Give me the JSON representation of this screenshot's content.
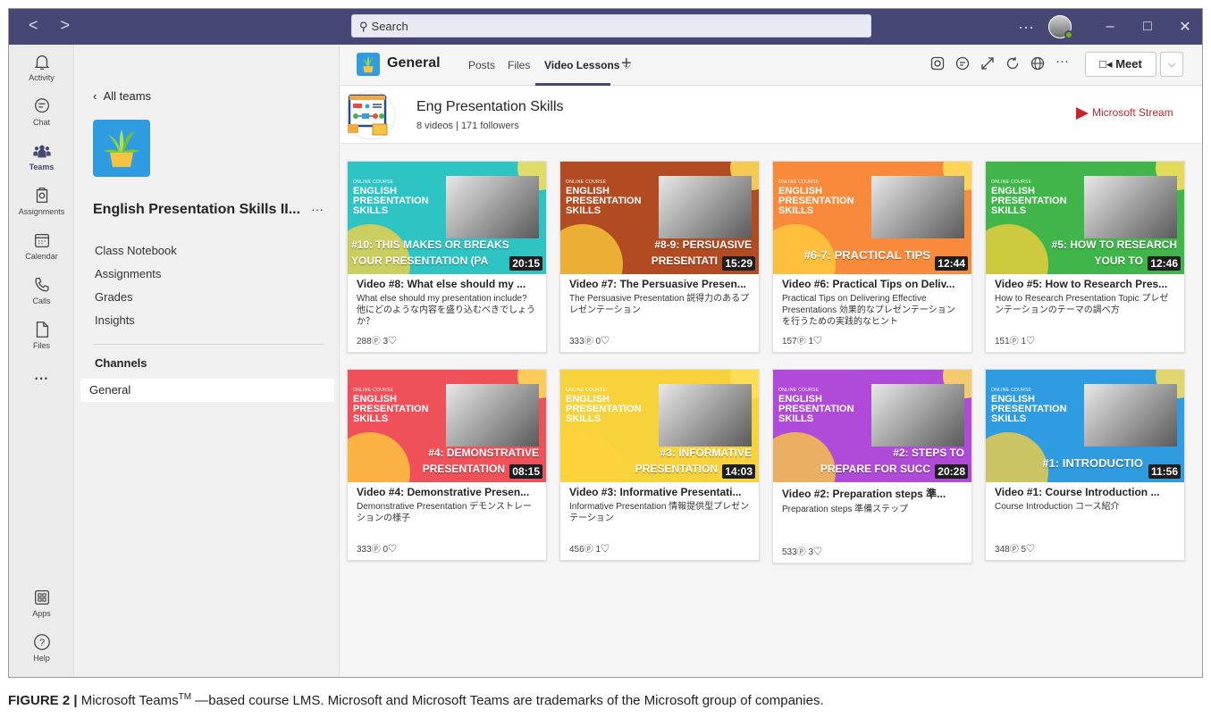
{
  "titlebar": {
    "back_forward": "< >",
    "search_placeholder": "Search",
    "more": "···",
    "minimize": "–",
    "maximize": "□",
    "close": "✕",
    "bg_color": "#464775"
  },
  "rail": [
    {
      "label": "Activity",
      "icon": "bell-icon"
    },
    {
      "label": "Chat",
      "icon": "chat-icon"
    },
    {
      "label": "Teams",
      "icon": "teams-icon"
    },
    {
      "label": "Assignments",
      "icon": "assignments-icon"
    },
    {
      "label": "Calendar",
      "icon": "calendar-icon"
    },
    {
      "label": "Calls",
      "icon": "phone-icon"
    },
    {
      "label": "Files",
      "icon": "file-icon"
    },
    {
      "label": "···",
      "icon": "more-icon"
    },
    {
      "label": "Apps",
      "icon": "apps-icon"
    },
    {
      "label": "Help",
      "icon": "help-icon"
    }
  ],
  "panel": {
    "back": "All teams",
    "team_name": "English Presentation Skills II...",
    "team_more": "···",
    "links": [
      "Class Notebook",
      "Assignments",
      "Grades",
      "Insights"
    ],
    "channels_heading": "Channels",
    "channels": [
      "General"
    ]
  },
  "channel_header": {
    "name": "General",
    "tabs": [
      "Posts",
      "Files",
      "Video Lessons"
    ],
    "active_tab": "Video Lessons",
    "tab_chevron": "⌵",
    "add_tab": "+",
    "meet_label": "Meet",
    "meet_chevron": "⌵"
  },
  "stream": {
    "title": "Eng Presentation Skills",
    "subtitle": "8 videos | 171 followers",
    "brand": "Microsoft Stream"
  },
  "thumb_common": {
    "course": "ONLINE COURSE",
    "title": "ENGLISH PRESENTATION SKILLS"
  },
  "videos": [
    {
      "banner": "#10: THIS MAKES OR BREAKS\nYOUR PRESENTATION (PA",
      "duration": "20:15",
      "title": "Video #8: What else should my ...",
      "desc": "What else should my presentation include? 他にどのような内容を盛り込むべきでしょうか？",
      "views": "288",
      "likes": "3",
      "color": "#2ec4c4"
    },
    {
      "banner": "#8-9: PERSUASIVE\nPRESENTATI",
      "duration": "15:29",
      "title": "Video #7: The Persuasive Presen...",
      "desc": "The Persuasive Presentation 説得力のあるプレゼンテーション",
      "views": "333",
      "likes": "0",
      "color": "#b24a22"
    },
    {
      "banner": "#6-7: PRACTICAL TIPS",
      "duration": "12:44",
      "title": "Video #6: Practical Tips on Deliv...",
      "desc": "Practical Tips on Delivering Effective Presentations 効果的なプレゼンテーションを行うための実践的なヒント",
      "views": "157",
      "likes": "1",
      "color": "#f98a3c"
    },
    {
      "banner": "#5: HOW TO RESEARCH\nYOUR TO",
      "duration": "12:46",
      "title": "Video #5: How to Research Pres...",
      "desc": "How to Research Presentation Topic プレゼンテーションのテーマの調べ方",
      "views": "151",
      "likes": "1",
      "color": "#3fb54a"
    },
    {
      "banner": "#4: DEMONSTRATIVE\nPRESENTATION",
      "duration": "08:15",
      "title": "Video #4: Demonstrative Presen...",
      "desc": "Demonstrative Presentation デモンストレーションの様子",
      "views": "333",
      "likes": "0",
      "color": "#f0505a"
    },
    {
      "banner": "#3: INFORMATIVE\nPRESENTATION",
      "duration": "14:03",
      "title": "Video #3: Informative Presentati...",
      "desc": "Informative Presentation 情報提供型プレゼンテーション",
      "views": "456",
      "likes": "1",
      "color": "#f7d23a"
    },
    {
      "banner": "#2: STEPS TO\nPREPARE FOR SUCC",
      "duration": "20:28",
      "title": "Video #2: Preparation steps 準...",
      "desc": "Preparation steps 準備ステップ",
      "views": "533",
      "likes": "3",
      "color": "#b04ad8"
    },
    {
      "banner": "#1: INTRODUCTIO",
      "duration": "11:56",
      "title": "Video #1: Course Introduction ...",
      "desc": "Course Introduction コース紹介",
      "views": "348",
      "likes": "5",
      "color": "#2f9be0"
    }
  ],
  "caption": {
    "label": "FIGURE 2 |",
    "text_before": " Microsoft Teams",
    "tm": "TM",
    "text_after": " —based course LMS. Microsoft and Microsoft Teams are trademarks of the Microsoft group of companies."
  }
}
